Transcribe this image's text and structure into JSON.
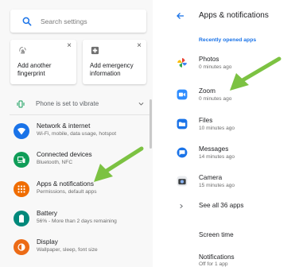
{
  "settings": {
    "search_placeholder": "Search settings",
    "suggestions": [
      {
        "label": "Add another fingerprint",
        "icon": "fingerprint-icon",
        "dismiss": "×"
      },
      {
        "label": "Add emergency information",
        "icon": "medical-plus-icon",
        "dismiss": "×"
      }
    ],
    "condition": {
      "text": "Phone is set to vibrate",
      "icon": "vibrate-icon"
    },
    "items": [
      {
        "title": "Network & internet",
        "subtitle": "Wi-Fi, mobile, data usage, hotspot",
        "icon": "wifi-icon",
        "color": "#1a73e8"
      },
      {
        "title": "Connected devices",
        "subtitle": "Bluetooth, NFC",
        "icon": "devices-icon",
        "color": "#0f9d58"
      },
      {
        "title": "Apps & notifications",
        "subtitle": "Permissions, default apps",
        "icon": "apps-grid-icon",
        "color": "#ef6c00"
      },
      {
        "title": "Battery",
        "subtitle": "56% - More than 2 days remaining",
        "icon": "battery-icon",
        "color": "#00897b"
      },
      {
        "title": "Display",
        "subtitle": "Wallpaper, sleep, font size",
        "icon": "display-icon",
        "color": "#ec6b16"
      }
    ]
  },
  "apps_screen": {
    "title": "Apps & notifications",
    "recent_header": "Recently opened apps",
    "recent_apps": [
      {
        "name": "Photos",
        "time": "0 minutes ago",
        "icon": "photos-pinwheel-icon"
      },
      {
        "name": "Zoom",
        "time": "0 minutes ago",
        "icon": "zoom-camera-icon"
      },
      {
        "name": "Files",
        "time": "10 minutes ago",
        "icon": "files-folder-icon"
      },
      {
        "name": "Messages",
        "time": "14 minutes ago",
        "icon": "messages-bubble-icon"
      },
      {
        "name": "Camera",
        "time": "15 minutes ago",
        "icon": "camera-icon"
      }
    ],
    "see_all": "See all 36 apps",
    "screen_time": "Screen time",
    "notifications": {
      "title": "Notifications",
      "subtitle": "Off for 1 app"
    }
  },
  "colors": {
    "accent": "#1a73e8",
    "arrow": "#7cc242"
  }
}
